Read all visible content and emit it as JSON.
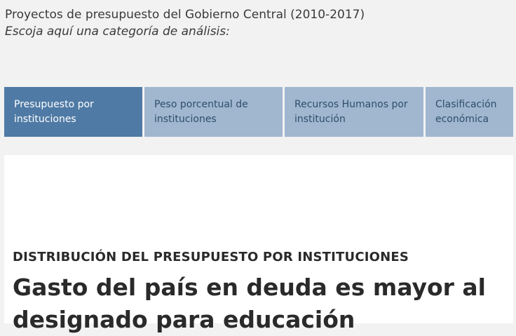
{
  "header": {
    "title": "Proyectos de presupuesto del Gobierno Central (2010-2017)",
    "subtitle": "Escoja aquí una categoría de análisis:"
  },
  "tabs": [
    {
      "label": "Presupuesto por instituciones",
      "active": true
    },
    {
      "label": "Peso porcentual de instituciones",
      "active": false
    },
    {
      "label": "Recursos Humanos por institución",
      "active": false
    },
    {
      "label": "Clasificación económica",
      "active": false
    }
  ],
  "article": {
    "kicker": "DISTRIBUCIÓN DEL PRESUPUESTO POR INSTITUCIONES",
    "headline": "Gasto del país en deuda es mayor al designado para educación"
  },
  "colors": {
    "tab_active": "#4f7aa5",
    "tab_inactive": "#a0b7cf",
    "background": "#f2f2f2"
  }
}
